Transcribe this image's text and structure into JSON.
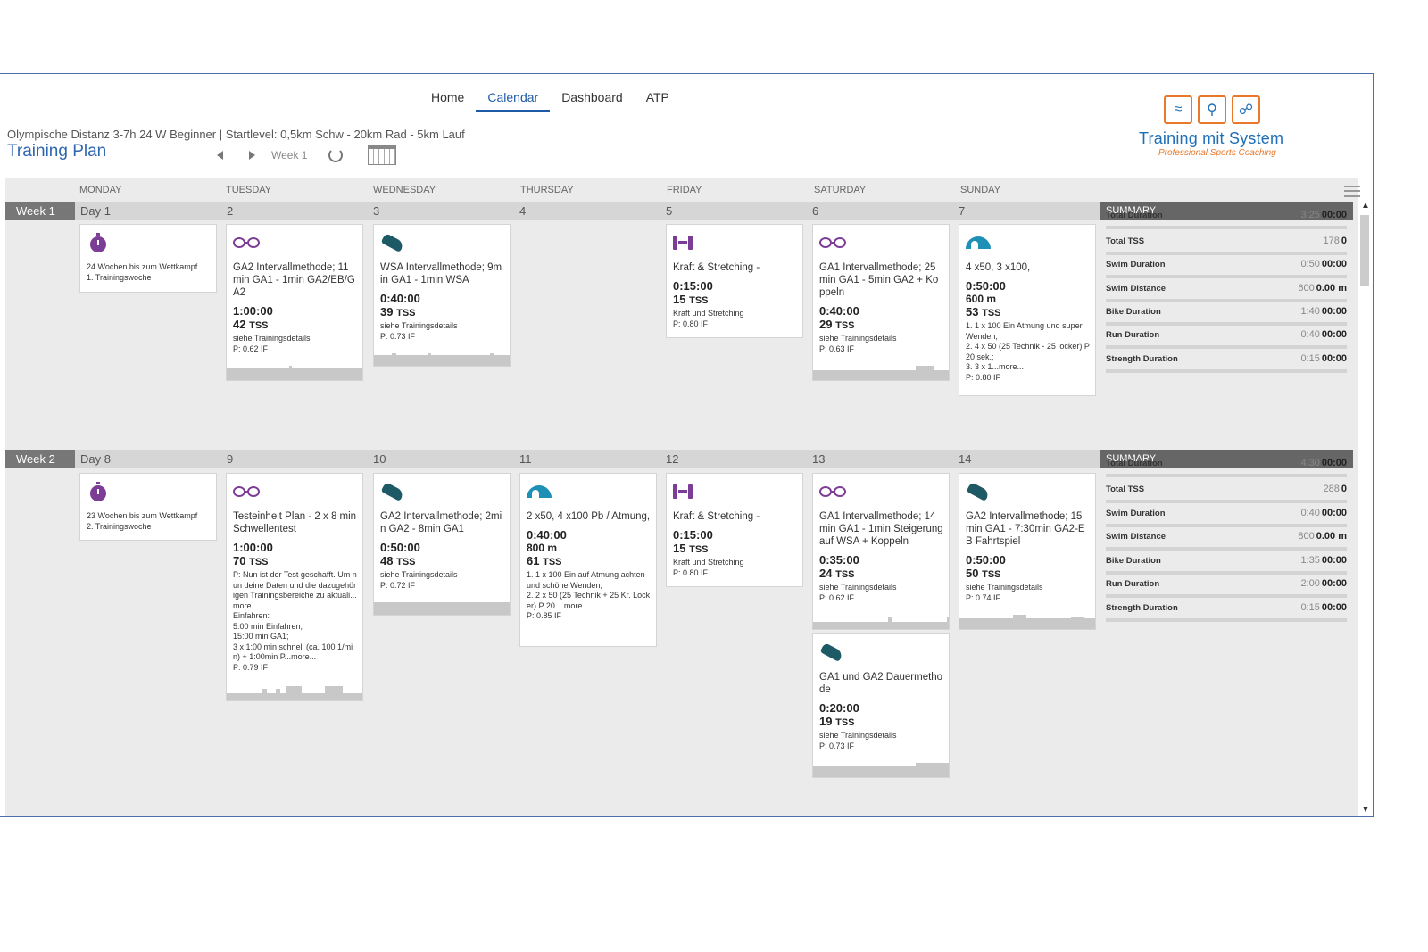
{
  "nav": [
    {
      "label": "Home",
      "active": false
    },
    {
      "label": "Calendar",
      "active": true
    },
    {
      "label": "Dashboard",
      "active": false
    },
    {
      "label": "ATP",
      "active": false
    }
  ],
  "plan": {
    "subtitle": "Olympische Distanz 3-7h 24 W Beginner | Startlevel: 0,5km Schw - 20km Rad - 5km Lauf",
    "title": "Training Plan",
    "week_label": "Week 1"
  },
  "logo": {
    "name": "Training mit System",
    "tagline": "Professional Sports Coaching"
  },
  "days": [
    "MONDAY",
    "TUESDAY",
    "WEDNESDAY",
    "THURSDAY",
    "FRIDAY",
    "SATURDAY",
    "SUNDAY"
  ],
  "weeks": [
    {
      "label": "Week 1",
      "day_numbers": [
        "Day 1",
        "2",
        "3",
        "4",
        "5",
        "6",
        "7"
      ],
      "summary_label": "SUMMARY",
      "summary": [
        {
          "key": "Total Duration",
          "planned": "3:25",
          "actual": "00:00"
        },
        {
          "key": "Total TSS",
          "planned": "178",
          "actual": "0"
        },
        {
          "key": "Swim Duration",
          "planned": "0:50",
          "actual": "00:00"
        },
        {
          "key": "Swim Distance",
          "planned": "600",
          "actual": "0.00 m"
        },
        {
          "key": "Bike Duration",
          "planned": "1:40",
          "actual": "00:00"
        },
        {
          "key": "Run Duration",
          "planned": "0:40",
          "actual": "00:00"
        },
        {
          "key": "Strength Duration",
          "planned": "0:15",
          "actual": "00:00"
        }
      ]
    },
    {
      "label": "Week 2",
      "day_numbers": [
        "Day 8",
        "9",
        "10",
        "11",
        "12",
        "13",
        "14"
      ],
      "summary_label": "SUMMARY",
      "summary": [
        {
          "key": "Total Duration",
          "planned": "4:30",
          "actual": "00:00"
        },
        {
          "key": "Total TSS",
          "planned": "288",
          "actual": "0"
        },
        {
          "key": "Swim Duration",
          "planned": "0:40",
          "actual": "00:00"
        },
        {
          "key": "Swim Distance",
          "planned": "800",
          "actual": "0.00 m"
        },
        {
          "key": "Bike Duration",
          "planned": "1:35",
          "actual": "00:00"
        },
        {
          "key": "Run Duration",
          "planned": "2:00",
          "actual": "00:00"
        },
        {
          "key": "Strength Duration",
          "planned": "0:15",
          "actual": "00:00"
        }
      ]
    }
  ],
  "workouts": {
    "w1_mon": {
      "icon": "stopwatch-icon",
      "note": "24 Wochen bis zum Wettkampf\n1. Trainingswoche"
    },
    "w1_tue": {
      "icon": "bike-icon",
      "title": "GA2 Intervallmethode; 11 min GA1 - 1min GA2/EB/GA2",
      "duration": "1:00:00",
      "tss": "42",
      "note": "siehe Trainingsdetails",
      "if": "P: 0.62 IF"
    },
    "w1_wed": {
      "icon": "run-icon",
      "title": "WSA Intervallmethode; 9m in GA1 - 1min WSA",
      "duration": "0:40:00",
      "tss": "39",
      "note": "siehe Trainingsdetails",
      "if": "P: 0.73 IF"
    },
    "w1_fri": {
      "icon": "strength-icon",
      "title": "Kraft & Stretching -",
      "duration": "0:15:00",
      "tss": "15",
      "note": "Kraft und Stretching",
      "if": "P: 0.80 IF"
    },
    "w1_sat": {
      "icon": "bike-icon",
      "title": "GA1 Intervallmethode; 25 min GA1 - 5min GA2 + Koppeln",
      "duration": "0:40:00",
      "tss": "29",
      "note": "siehe Trainingsdetails",
      "if": "P: 0.63 IF"
    },
    "w1_sun": {
      "icon": "swim-icon",
      "title": "4 x50, 3 x100,",
      "duration": "0:50:00",
      "distance": "600",
      "distance_unit": "m",
      "tss": "53",
      "note": "1. 1 x 100 Ein Atmung und super Wenden;\n2. 4 x 50 (25 Technik - 25 locker) P 20 sek.;\n3. 3 x 1...more...",
      "if": "P: 0.80 IF"
    },
    "w2_mon": {
      "icon": "stopwatch-icon",
      "note": "23 Wochen bis zum Wettkampf\n2. Trainingswoche"
    },
    "w2_tue": {
      "icon": "bike-icon",
      "title": "Testeinheit Plan - 2 x 8 min Schwellentest",
      "duration": "1:00:00",
      "tss": "70",
      "note": "P: Nun ist der Test geschafft. Um nun deine Daten und die dazugehörigen Trainingsbereiche zu aktuali...more...\nEinfahren:\n5:00 min Einfahren;\n15:00 min GA1;\n3 x 1:00 min schnell (ca. 100 1/min) + 1:00min P...more...",
      "if": "P: 0.79 IF"
    },
    "w2_wed": {
      "icon": "run-icon",
      "title": "GA2 Intervallmethode; 2min GA2 - 8min GA1",
      "duration": "0:50:00",
      "tss": "48",
      "note": "siehe Trainingsdetails",
      "if": "P: 0.72 IF"
    },
    "w2_thu": {
      "icon": "swim-icon",
      "title": "2 x50, 4 x100 Pb / Atmung,",
      "duration": "0:40:00",
      "distance": "800",
      "distance_unit": "m",
      "tss": "61",
      "note": "1. 1 x 100 Ein auf Atmung achten und schöne Wenden;\n2. 2 x 50 (25 Technik + 25 Kr. Locker) P 20 ...more...",
      "if": "P: 0.85 IF"
    },
    "w2_fri": {
      "icon": "strength-icon",
      "title": "Kraft & Stretching -",
      "duration": "0:15:00",
      "tss": "15",
      "note": "Kraft und Stretching",
      "if": "P: 0.80 IF"
    },
    "w2_sat": {
      "icon": "bike-icon",
      "title": "GA1 Intervallmethode; 14 min GA1 - 1min Steigerung auf WSA + Koppeln",
      "duration": "0:35:00",
      "tss": "24",
      "note": "siehe Trainingsdetails",
      "if": "P: 0.62 IF"
    },
    "w2_sat2": {
      "icon": "run-icon",
      "title": "GA1 und GA2 Dauermethode",
      "duration": "0:20:00",
      "tss": "19",
      "note": "siehe Trainingsdetails",
      "if": "P: 0.73 IF"
    },
    "w2_sun": {
      "icon": "run-icon",
      "title": "GA2 Intervallmethode; 15 min GA1 - 7:30min GA2-EB Fahrtspiel",
      "duration": "0:50:00",
      "tss": "50",
      "note": "siehe Trainingsdetails",
      "if": "P: 0.74 IF"
    }
  },
  "tss_unit": "TSS",
  "colors": {
    "accent": "#2f66b0",
    "bike": "#7b3d95",
    "run": "#1e5a66",
    "swim": "#1e8fb5",
    "logo_orange": "#e9782a"
  }
}
